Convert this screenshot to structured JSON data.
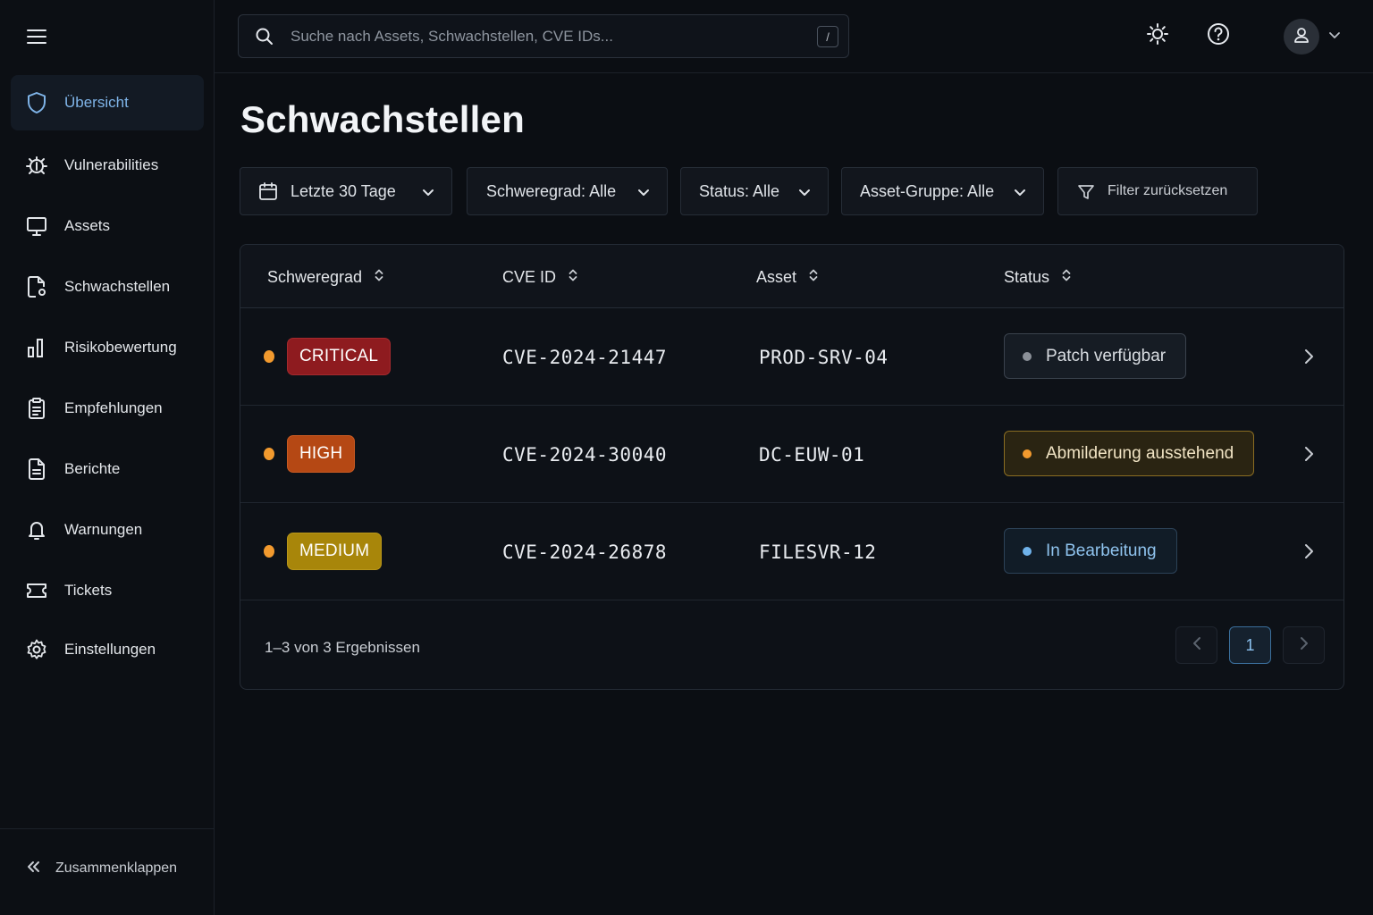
{
  "sidebar": {
    "items": [
      {
        "label": "Übersicht",
        "icon": "shield-icon",
        "active": true
      },
      {
        "label": "Vulnerabilities",
        "icon": "bug-icon"
      },
      {
        "label": "Assets",
        "icon": "monitor-icon"
      },
      {
        "label": "Schwachstellen",
        "icon": "file-gear-icon"
      },
      {
        "label": "Risikobewertung",
        "icon": "bar-chart-icon"
      },
      {
        "label": "Empfehlungen",
        "icon": "clipboard-icon"
      },
      {
        "label": "Berichte",
        "icon": "document-icon"
      },
      {
        "label": "Warnungen",
        "icon": "bell-icon"
      },
      {
        "label": "Tickets",
        "icon": "ticket-icon"
      },
      {
        "label": "Einstellungen",
        "icon": "gear-icon"
      }
    ],
    "collapse_label": "Zusammenklappen"
  },
  "search": {
    "placeholder": "Suche nach Assets, Schwachstellen, CVE IDs...",
    "shortcut": "/"
  },
  "page": {
    "title": "Schwachstellen"
  },
  "filters": {
    "date": "Letzte 30 Tage",
    "severity": "Schweregrad: Alle",
    "status": "Status: Alle",
    "asset_group": "Asset-Gruppe: Alle",
    "reset": "Filter zurücksetzen"
  },
  "table": {
    "headers": {
      "severity": "Schweregrad",
      "cve": "CVE ID",
      "asset": "Asset",
      "status": "Status"
    },
    "rows": [
      {
        "severity": "CRITICAL",
        "cve": "CVE-2024-21447",
        "asset": "PROD-SRV-04",
        "status": "Patch verfügbar"
      },
      {
        "severity": "HIGH",
        "cve": "CVE-2024-30040",
        "asset": "DC-EUW-01",
        "status": "Abmilderung ausstehend"
      },
      {
        "severity": "MEDIUM",
        "cve": "CVE-2024-26878",
        "asset": "FILESVR-12",
        "status": "In Bearbeitung"
      }
    ],
    "summary": "1–3 von 3 Ergebnissen",
    "current_page": "1"
  },
  "colors": {
    "critical": "#8e1b1f",
    "high": "#b54814",
    "medium": "#a8860a",
    "accent": "#7fb4e8",
    "pending_dot": "#f29a2e"
  }
}
